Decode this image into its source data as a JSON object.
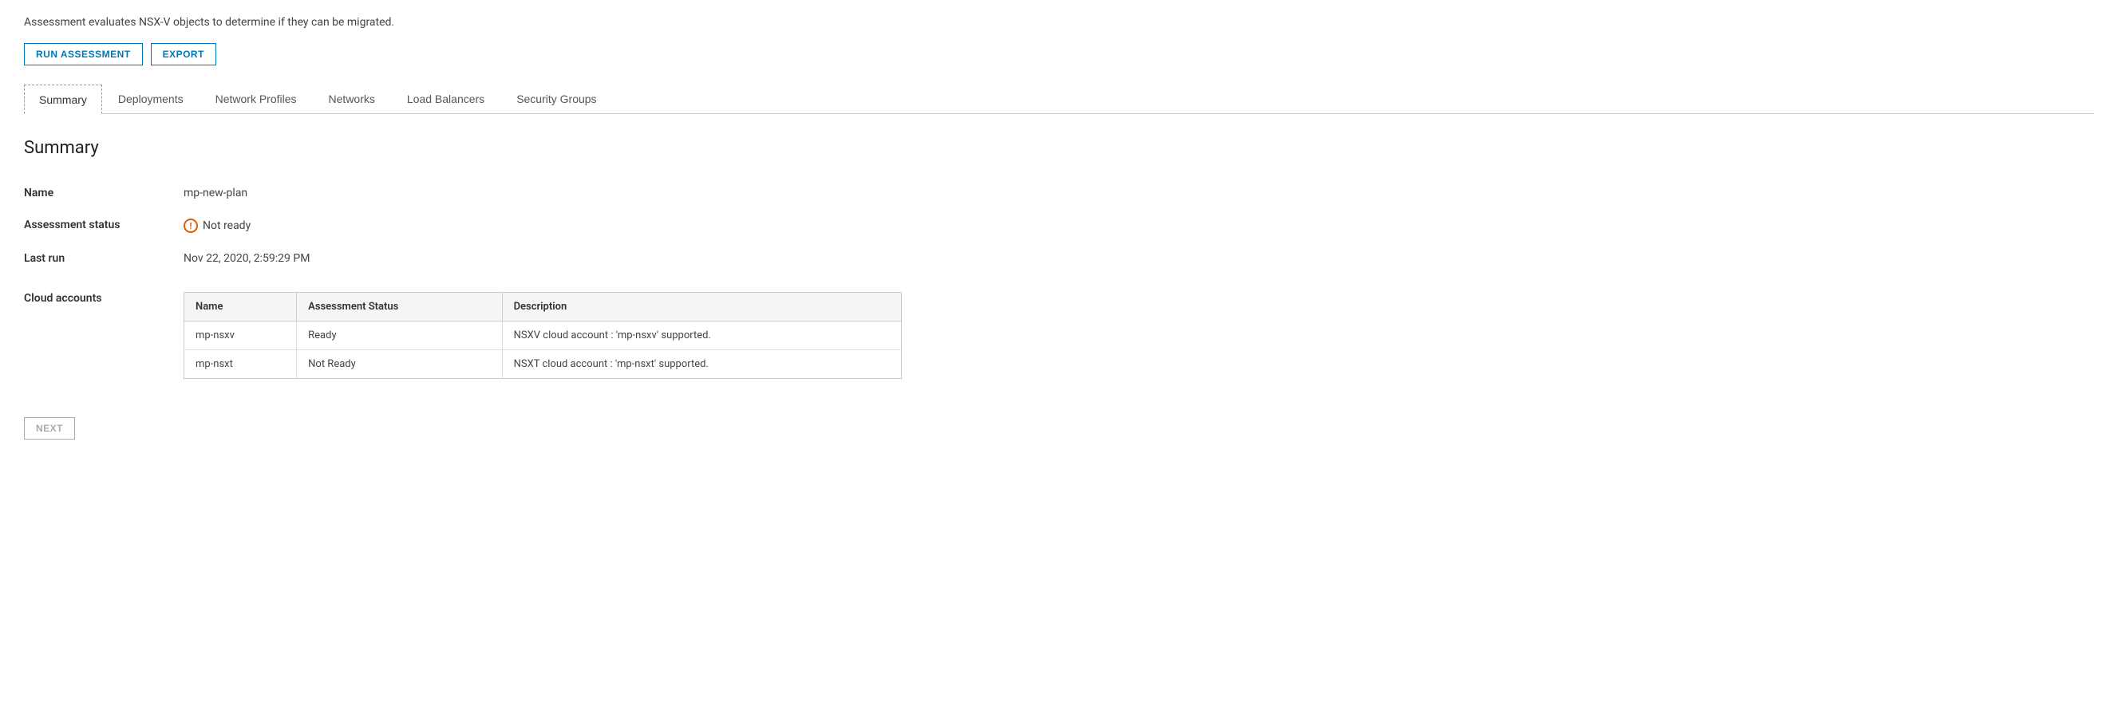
{
  "description": "Assessment evaluates NSX-V objects to determine if they can be migrated.",
  "toolbar": {
    "run_assessment_label": "RUN ASSESSMENT",
    "export_label": "EXPORT"
  },
  "tabs": [
    {
      "id": "summary",
      "label": "Summary",
      "active": true
    },
    {
      "id": "deployments",
      "label": "Deployments",
      "active": false
    },
    {
      "id": "network-profiles",
      "label": "Network Profiles",
      "active": false
    },
    {
      "id": "networks",
      "label": "Networks",
      "active": false
    },
    {
      "id": "load-balancers",
      "label": "Load Balancers",
      "active": false
    },
    {
      "id": "security-groups",
      "label": "Security Groups",
      "active": false
    }
  ],
  "summary": {
    "title": "Summary",
    "name_label": "Name",
    "name_value": "mp-new-plan",
    "assessment_status_label": "Assessment status",
    "assessment_status_value": "Not ready",
    "last_run_label": "Last run",
    "last_run_value": "Nov 22, 2020, 2:59:29 PM",
    "cloud_accounts_label": "Cloud accounts",
    "cloud_accounts_table": {
      "columns": [
        "Name",
        "Assessment Status",
        "Description"
      ],
      "rows": [
        {
          "name": "mp-nsxv",
          "assessment_status": "Ready",
          "description": "NSXV cloud account : 'mp-nsxv' supported."
        },
        {
          "name": "mp-nsxt",
          "assessment_status": "Not Ready",
          "description": "NSXT cloud account : 'mp-nsxt' supported."
        }
      ]
    }
  },
  "bottom_toolbar": {
    "next_label": "NEXT"
  },
  "colors": {
    "accent": "#0077b6",
    "status_warning": "#e05c00"
  }
}
